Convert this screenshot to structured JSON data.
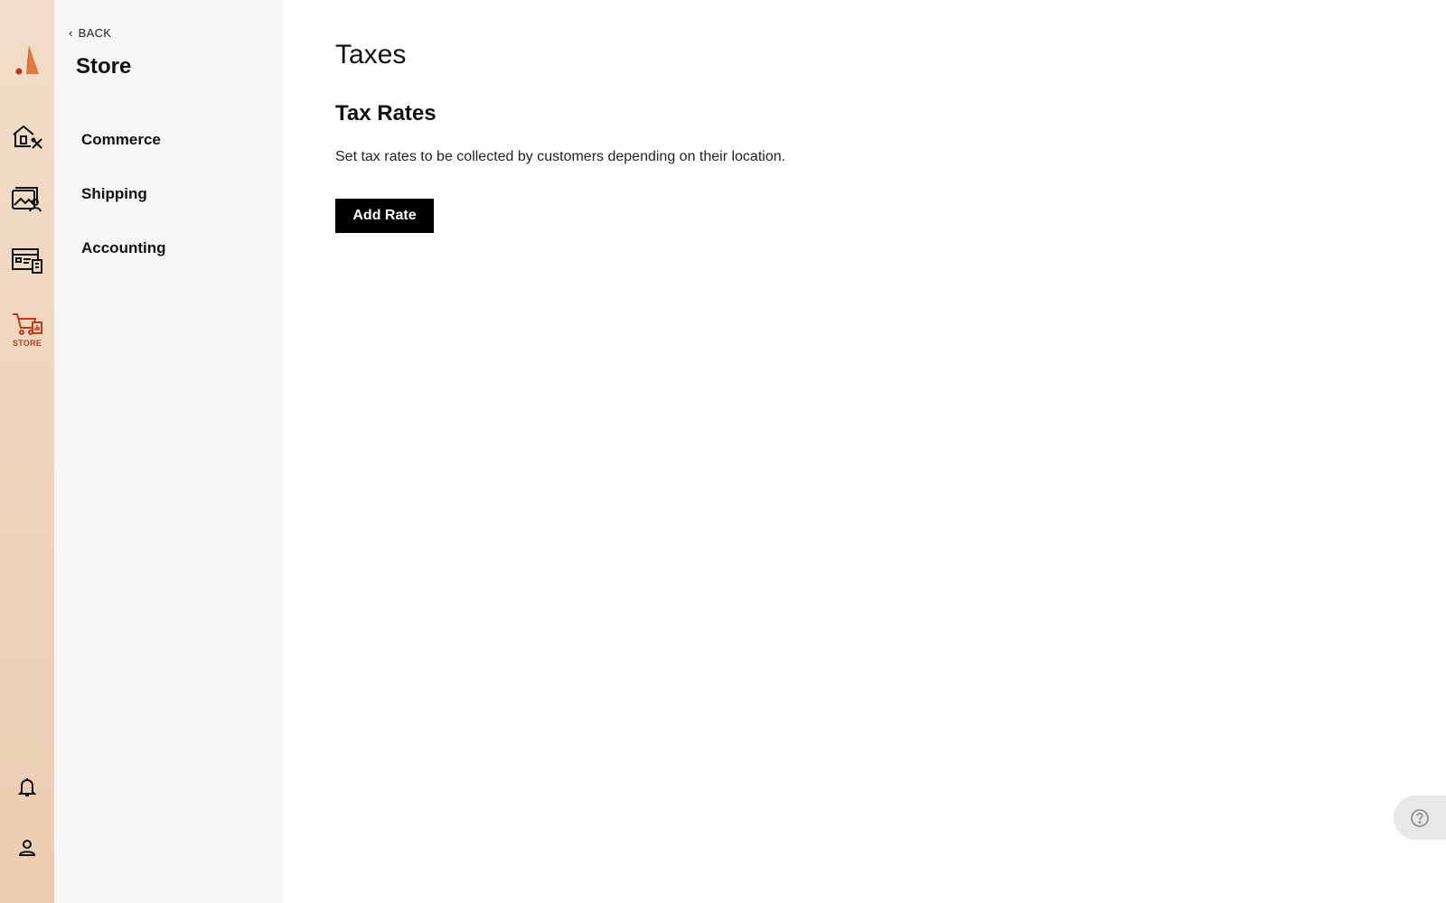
{
  "rail": {
    "active_label": "STORE",
    "accent": "#c0391b",
    "logo_color": "#e0793a"
  },
  "subnav": {
    "back_label": "BACK",
    "title": "Store",
    "items": [
      {
        "label": "Commerce"
      },
      {
        "label": "Shipping"
      },
      {
        "label": "Accounting"
      }
    ]
  },
  "main": {
    "page_title": "Taxes",
    "section_title": "Tax Rates",
    "section_description": "Set tax rates to be collected by customers depending on their location.",
    "add_button_label": "Add Rate"
  }
}
